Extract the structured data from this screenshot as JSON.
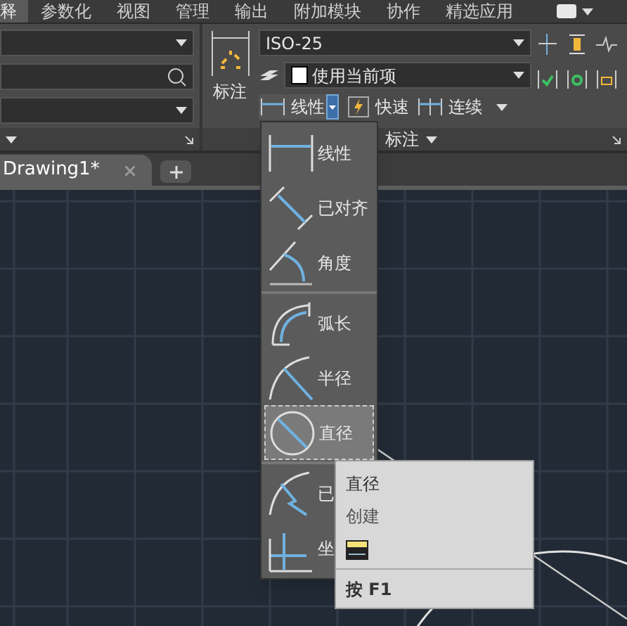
{
  "menu_tabs": [
    {
      "label": "释",
      "selected": true
    },
    {
      "label": "参数化",
      "selected": false
    },
    {
      "label": "视图",
      "selected": false
    },
    {
      "label": "管理",
      "selected": false
    },
    {
      "label": "输出",
      "selected": false
    },
    {
      "label": "附加模块",
      "selected": false
    },
    {
      "label": "协作",
      "selected": false
    },
    {
      "label": "精选应用",
      "selected": false
    }
  ],
  "dimension_panel": {
    "big_button": "标注",
    "style_field": {
      "value": "ISO-25"
    },
    "layer_field": {
      "value": "使用当前项"
    },
    "buttons": [
      {
        "kind": "split",
        "label": "线性"
      },
      {
        "kind": "quick",
        "label": "快速"
      },
      {
        "kind": "continue",
        "label": "连续"
      }
    ],
    "title": "标注"
  },
  "document_tabs": [
    {
      "label": "Drawing1*",
      "selected": true
    }
  ],
  "dropdown": {
    "items": [
      {
        "kind": "linear",
        "label": "线性",
        "selected": false,
        "separator_before": false
      },
      {
        "kind": "aligned",
        "label": "已对齐",
        "selected": false,
        "separator_before": false
      },
      {
        "kind": "angular",
        "label": "角度",
        "selected": false,
        "separator_before": false
      },
      {
        "kind": "arc",
        "label": "弧长",
        "selected": false,
        "separator_before": true
      },
      {
        "kind": "radius",
        "label": "半径",
        "selected": false,
        "separator_before": false
      },
      {
        "kind": "diameter",
        "label": "直径",
        "selected": true,
        "separator_before": false
      },
      {
        "kind": "jogged",
        "label": "已",
        "selected": false,
        "separator_before": true
      },
      {
        "kind": "ordinate",
        "label": "坐",
        "selected": false,
        "separator_before": false
      }
    ]
  },
  "tooltip": {
    "title": "直径",
    "description": "创建",
    "help": "按 F1"
  }
}
